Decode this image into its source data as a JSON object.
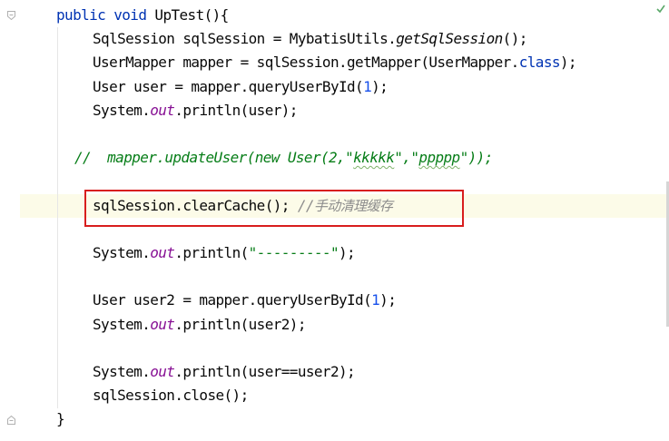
{
  "editor": {
    "lines": [
      {
        "indent": 40,
        "tokens": [
          {
            "t": "public void ",
            "c": "kw"
          },
          {
            "t": "UpTest(){",
            "c": ""
          }
        ]
      },
      {
        "indent": 80,
        "tokens": [
          {
            "t": "SqlSession sqlSession = MybatisUtils.",
            "c": ""
          },
          {
            "t": "getSqlSession",
            "c": "it"
          },
          {
            "t": "();",
            "c": ""
          }
        ]
      },
      {
        "indent": 80,
        "tokens": [
          {
            "t": "UserMapper mapper = sqlSession.getMapper(UserMapper.",
            "c": ""
          },
          {
            "t": "class",
            "c": "kw"
          },
          {
            "t": ");",
            "c": ""
          }
        ]
      },
      {
        "indent": 80,
        "tokens": [
          {
            "t": "User user = mapper.queryUserById(",
            "c": ""
          },
          {
            "t": "1",
            "c": "num"
          },
          {
            "t": ");",
            "c": ""
          }
        ]
      },
      {
        "indent": 80,
        "tokens": [
          {
            "t": "System.",
            "c": ""
          },
          {
            "t": "out",
            "c": "field"
          },
          {
            "t": ".println(user);",
            "c": ""
          }
        ]
      },
      {
        "indent": 0,
        "tokens": []
      },
      {
        "indent": 60,
        "tokens": [
          {
            "t": "//  mapper.updateUser(new User(2,\"",
            "c": "cmt-green"
          },
          {
            "t": "kkkkk",
            "c": "cmt-green squiggle"
          },
          {
            "t": "\",\"",
            "c": "cmt-green"
          },
          {
            "t": "ppppp",
            "c": "cmt-green squiggle"
          },
          {
            "t": "\"));",
            "c": "cmt-green"
          }
        ]
      },
      {
        "indent": 0,
        "tokens": []
      },
      {
        "indent": 80,
        "tokens": [
          {
            "t": "sqlSession.clearCache(); ",
            "c": ""
          },
          {
            "t": "//",
            "c": "cmt"
          },
          {
            "t": "手动清理缓存",
            "c": "cmt-cn"
          }
        ]
      },
      {
        "indent": 0,
        "tokens": []
      },
      {
        "indent": 80,
        "tokens": [
          {
            "t": "System.",
            "c": ""
          },
          {
            "t": "out",
            "c": "field"
          },
          {
            "t": ".println(",
            "c": ""
          },
          {
            "t": "\"---------\"",
            "c": "str"
          },
          {
            "t": ");",
            "c": ""
          }
        ]
      },
      {
        "indent": 0,
        "tokens": []
      },
      {
        "indent": 80,
        "tokens": [
          {
            "t": "User user2 = mapper.queryUserById(",
            "c": ""
          },
          {
            "t": "1",
            "c": "num"
          },
          {
            "t": ");",
            "c": ""
          }
        ]
      },
      {
        "indent": 80,
        "tokens": [
          {
            "t": "System.",
            "c": ""
          },
          {
            "t": "out",
            "c": "field"
          },
          {
            "t": ".println(user2);",
            "c": ""
          }
        ]
      },
      {
        "indent": 0,
        "tokens": []
      },
      {
        "indent": 80,
        "tokens": [
          {
            "t": "System.",
            "c": ""
          },
          {
            "t": "out",
            "c": "field"
          },
          {
            "t": ".println(user==user2);",
            "c": ""
          }
        ]
      },
      {
        "indent": 80,
        "tokens": [
          {
            "t": "sqlSession.close();",
            "c": ""
          }
        ]
      },
      {
        "indent": 40,
        "tokens": [
          {
            "t": "}",
            "c": ""
          }
        ]
      }
    ]
  },
  "colors": {
    "keyword": "#0033b3",
    "number": "#1750eb",
    "string": "#067d17",
    "field": "#871094",
    "comment": "#8c8c8c",
    "highlight_border": "#d81e1e",
    "caret_row": "#fcfbe8"
  },
  "icons": {
    "fold_top": "fold-collapse-icon",
    "fold_bottom": "fold-expand-icon",
    "inspection": "inspection-ok-icon"
  }
}
